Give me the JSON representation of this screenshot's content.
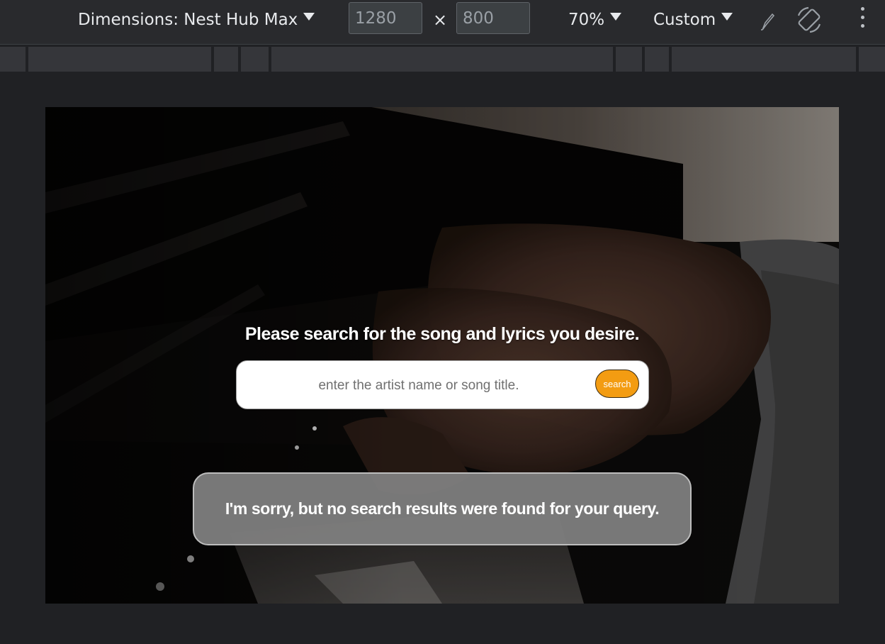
{
  "toolbar": {
    "dimensions_label": "Dimensions: Nest Hub Max",
    "width_value": "1280",
    "height_value": "800",
    "times_symbol": "×",
    "zoom_label": "70%",
    "throttle_label": "Custom",
    "icons": [
      "pen-icon",
      "rotate-icon",
      "more-options-icon"
    ]
  },
  "page": {
    "heading": "Please search for the song and lyrics you desire.",
    "search": {
      "placeholder": "enter the artist name or song title.",
      "value": "",
      "button_label": "search"
    },
    "result_message": "I'm sorry, but no search results were found for your query."
  },
  "colors": {
    "devtools_bg": "#202124",
    "toolbar_bg": "#292a2d",
    "search_button": "#f39c12",
    "result_box": "#808080"
  }
}
